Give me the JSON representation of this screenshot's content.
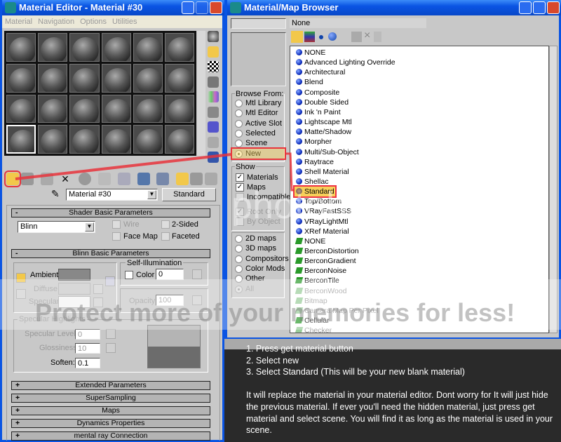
{
  "editor": {
    "title": "Material Editor - Material #30",
    "menu": [
      "Material",
      "Navigation",
      "Options",
      "Utilities"
    ],
    "material_name": "Material #30",
    "material_type": "Standard",
    "rollouts": {
      "shader_basic": "Shader Basic Parameters",
      "blinn_basic": "Blinn Basic Parameters",
      "collapsed": [
        "Extended Parameters",
        "SuperSampling",
        "Maps",
        "Dynamics Properties",
        "mental ray Connection"
      ],
      "minus": "-",
      "plus": "+"
    },
    "shader": {
      "value": "Blinn",
      "wire": "Wire",
      "two_sided": "2-Sided",
      "face_map": "Face Map",
      "faceted": "Faceted"
    },
    "blinn": {
      "ambient": "Ambient:",
      "diffuse": "Diffuse:",
      "specular": "Specular:",
      "self_illum": "Self-Illumination",
      "color": "Color",
      "color_value": "0",
      "opacity": "Opacity:",
      "opacity_value": "100"
    },
    "spec": {
      "group": "Specular Highlights",
      "level": "Specular Level:",
      "level_value": "0",
      "gloss": "Glossiness:",
      "gloss_value": "10",
      "soften": "Soften:",
      "soften_value": "0.1"
    }
  },
  "browser": {
    "title": "Material/Map Browser",
    "selected_name": "None",
    "browse_from": {
      "label": "Browse From:",
      "options": [
        "Mtl Library",
        "Mtl Editor",
        "Active Slot",
        "Selected",
        "Scene",
        "New"
      ],
      "selected": "New"
    },
    "show": {
      "label": "Show",
      "materials": "Materials",
      "maps": "Maps",
      "incompatible": "Incompatible",
      "root_only": "Root Only",
      "by_object": "By Object"
    },
    "map_types": {
      "options": [
        "2D maps",
        "3D maps",
        "Compositors",
        "Color Mods",
        "Other",
        "All"
      ],
      "selected": "All"
    },
    "items": [
      {
        "label": "NONE",
        "kind": "mat"
      },
      {
        "label": "Advanced Lighting Override",
        "kind": "mat"
      },
      {
        "label": "Architectural",
        "kind": "mat"
      },
      {
        "label": "Blend",
        "kind": "mat"
      },
      {
        "label": "Composite",
        "kind": "mat"
      },
      {
        "label": "Double Sided",
        "kind": "mat"
      },
      {
        "label": "Ink 'n Paint",
        "kind": "mat"
      },
      {
        "label": "Lightscape Mtl",
        "kind": "mat"
      },
      {
        "label": "Matte/Shadow",
        "kind": "mat"
      },
      {
        "label": "Morpher",
        "kind": "mat"
      },
      {
        "label": "Multi/Sub-Object",
        "kind": "mat"
      },
      {
        "label": "Raytrace",
        "kind": "mat"
      },
      {
        "label": "Shell Material",
        "kind": "mat"
      },
      {
        "label": "Shellac",
        "kind": "mat"
      },
      {
        "label": "Standard",
        "kind": "mat",
        "selected": true
      },
      {
        "label": "Top/Bottom",
        "kind": "mat"
      },
      {
        "label": "VRayFastSSS",
        "kind": "mat"
      },
      {
        "label": "VRayLightMtl",
        "kind": "mat"
      },
      {
        "label": "XRef Material",
        "kind": "mat"
      },
      {
        "label": "NONE",
        "kind": "map"
      },
      {
        "label": "BerconDistortion",
        "kind": "map"
      },
      {
        "label": "BerconGradient",
        "kind": "map"
      },
      {
        "label": "BerconNoise",
        "kind": "map"
      },
      {
        "label": "BerconTile",
        "kind": "map"
      },
      {
        "label": "BerconWood",
        "kind": "map",
        "dim": true
      },
      {
        "label": "Bitmap",
        "kind": "map",
        "dim": true
      },
      {
        "label": "Camera Map Per Pixel",
        "kind": "map",
        "dim": true
      },
      {
        "label": "Cellular",
        "kind": "map"
      },
      {
        "label": "Checker",
        "kind": "map",
        "dim": true
      }
    ]
  },
  "instructions": {
    "steps": "1. Press get material button\n2. Select new\n3. Select Standard (This will be your new blank material)",
    "note": "It will replace the material in your material editor. Dont worry for It will just hide the previous material. If ever you'll need the hidden material, just press get material and select scene. You will find it as long as the material is used in your scene."
  },
  "watermark": {
    "logo": "photobucket",
    "text": "Protect more of your memories for less!"
  },
  "colors": {
    "titlebar": "#0a54e3",
    "highlight": "#f7d05a",
    "annotation": "#e8343c",
    "panel": "#c8c8c8"
  }
}
